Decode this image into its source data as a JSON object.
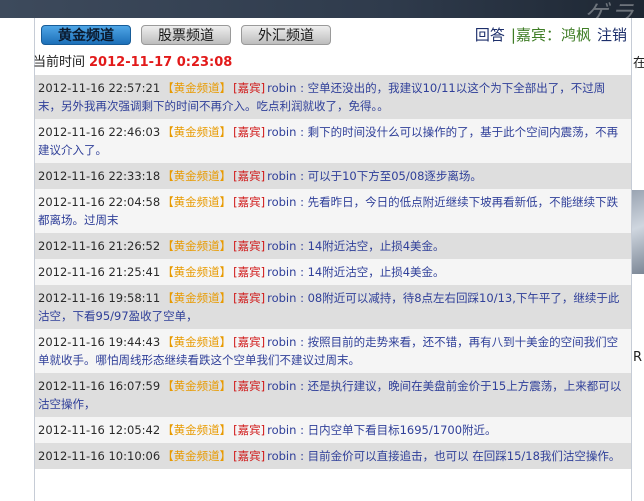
{
  "banner": {
    "deco_text": "ゲラ"
  },
  "tabs": [
    {
      "label": "黄金频道",
      "active": true
    },
    {
      "label": "股票频道",
      "active": false
    },
    {
      "label": "外汇频道",
      "active": false
    }
  ],
  "userbar": {
    "answer": "回答",
    "guest": "|嘉宾：鸿枫",
    "logout": "注销"
  },
  "current_time": {
    "label": "当前时间",
    "value": "2012-11-17 0:23:08"
  },
  "messages": [
    {
      "time": "2012-11-16 22:57:21",
      "channel": "【黄金频道】",
      "role": "[嘉宾]",
      "user": "robin",
      "text": " : 空单还没出的，我建议10/11以这个为下全部出了，不过周末，另外我再次强调剩下的时间不再介入。吃点利润就收了，免得。。"
    },
    {
      "time": "2012-11-16 22:46:03",
      "channel": "【黄金频道】",
      "role": "[嘉宾]",
      "user": "robin",
      "text": " : 剩下的时间没什么可以操作的了，基于此个空间内震荡，不再建议介入了。"
    },
    {
      "time": "2012-11-16 22:33:18",
      "channel": "【黄金频道】",
      "role": "[嘉宾]",
      "user": "robin",
      "text": " : 可以于10下方至05/08逐步离场。"
    },
    {
      "time": "2012-11-16 22:04:58",
      "channel": "【黄金频道】",
      "role": "[嘉宾]",
      "user": "robin",
      "text": " : 先看昨日，今日的低点附近继续下坡再看新低，不能继续下跌都离场。过周末"
    },
    {
      "time": "2012-11-16 21:26:52",
      "channel": "【黄金频道】",
      "role": "[嘉宾]",
      "user": "robin",
      "text": " : 14附近沽空，止损4美金。"
    },
    {
      "time": "2012-11-16 21:25:41",
      "channel": "【黄金频道】",
      "role": "[嘉宾]",
      "user": "robin",
      "text": " : 14附近沽空，止损4美金。"
    },
    {
      "time": "2012-11-16 19:58:11",
      "channel": "【黄金频道】",
      "role": "[嘉宾]",
      "user": "robin",
      "text": " : 08附近可以减持，待8点左右回踩10/13,下午平了，继续于此沽空，下看95/97盈收了空单，"
    },
    {
      "time": "2012-11-16 19:44:43",
      "channel": "【黄金频道】",
      "role": "[嘉宾]",
      "user": "robin",
      "text": " : 按照目前的走势来看，还不错，再有八到十美金的空间我们空单就收手。哪怕周线形态继续看跌这个空单我们不建议过周末。"
    },
    {
      "time": "2012-11-16 16:07:59",
      "channel": "【黄金频道】",
      "role": "[嘉宾]",
      "user": "robin",
      "text": " : 还是执行建议，晚间在美盘前金价于15上方震荡，上来都可以沽空操作，"
    },
    {
      "time": "2012-11-16 12:05:42",
      "channel": "【黄金频道】",
      "role": "[嘉宾]",
      "user": "robin",
      "text": " : 日内空单下看目标1695/1700附近。"
    },
    {
      "time": "2012-11-16 10:10:06",
      "channel": "【黄金频道】",
      "role": "[嘉宾]",
      "user": "robin",
      "text": " : 目前金价可以直接追击，也可以 在回踩15/18我们沽空操作。"
    }
  ],
  "right_column": {
    "glyph_1": "在",
    "glyph_2": "R"
  }
}
